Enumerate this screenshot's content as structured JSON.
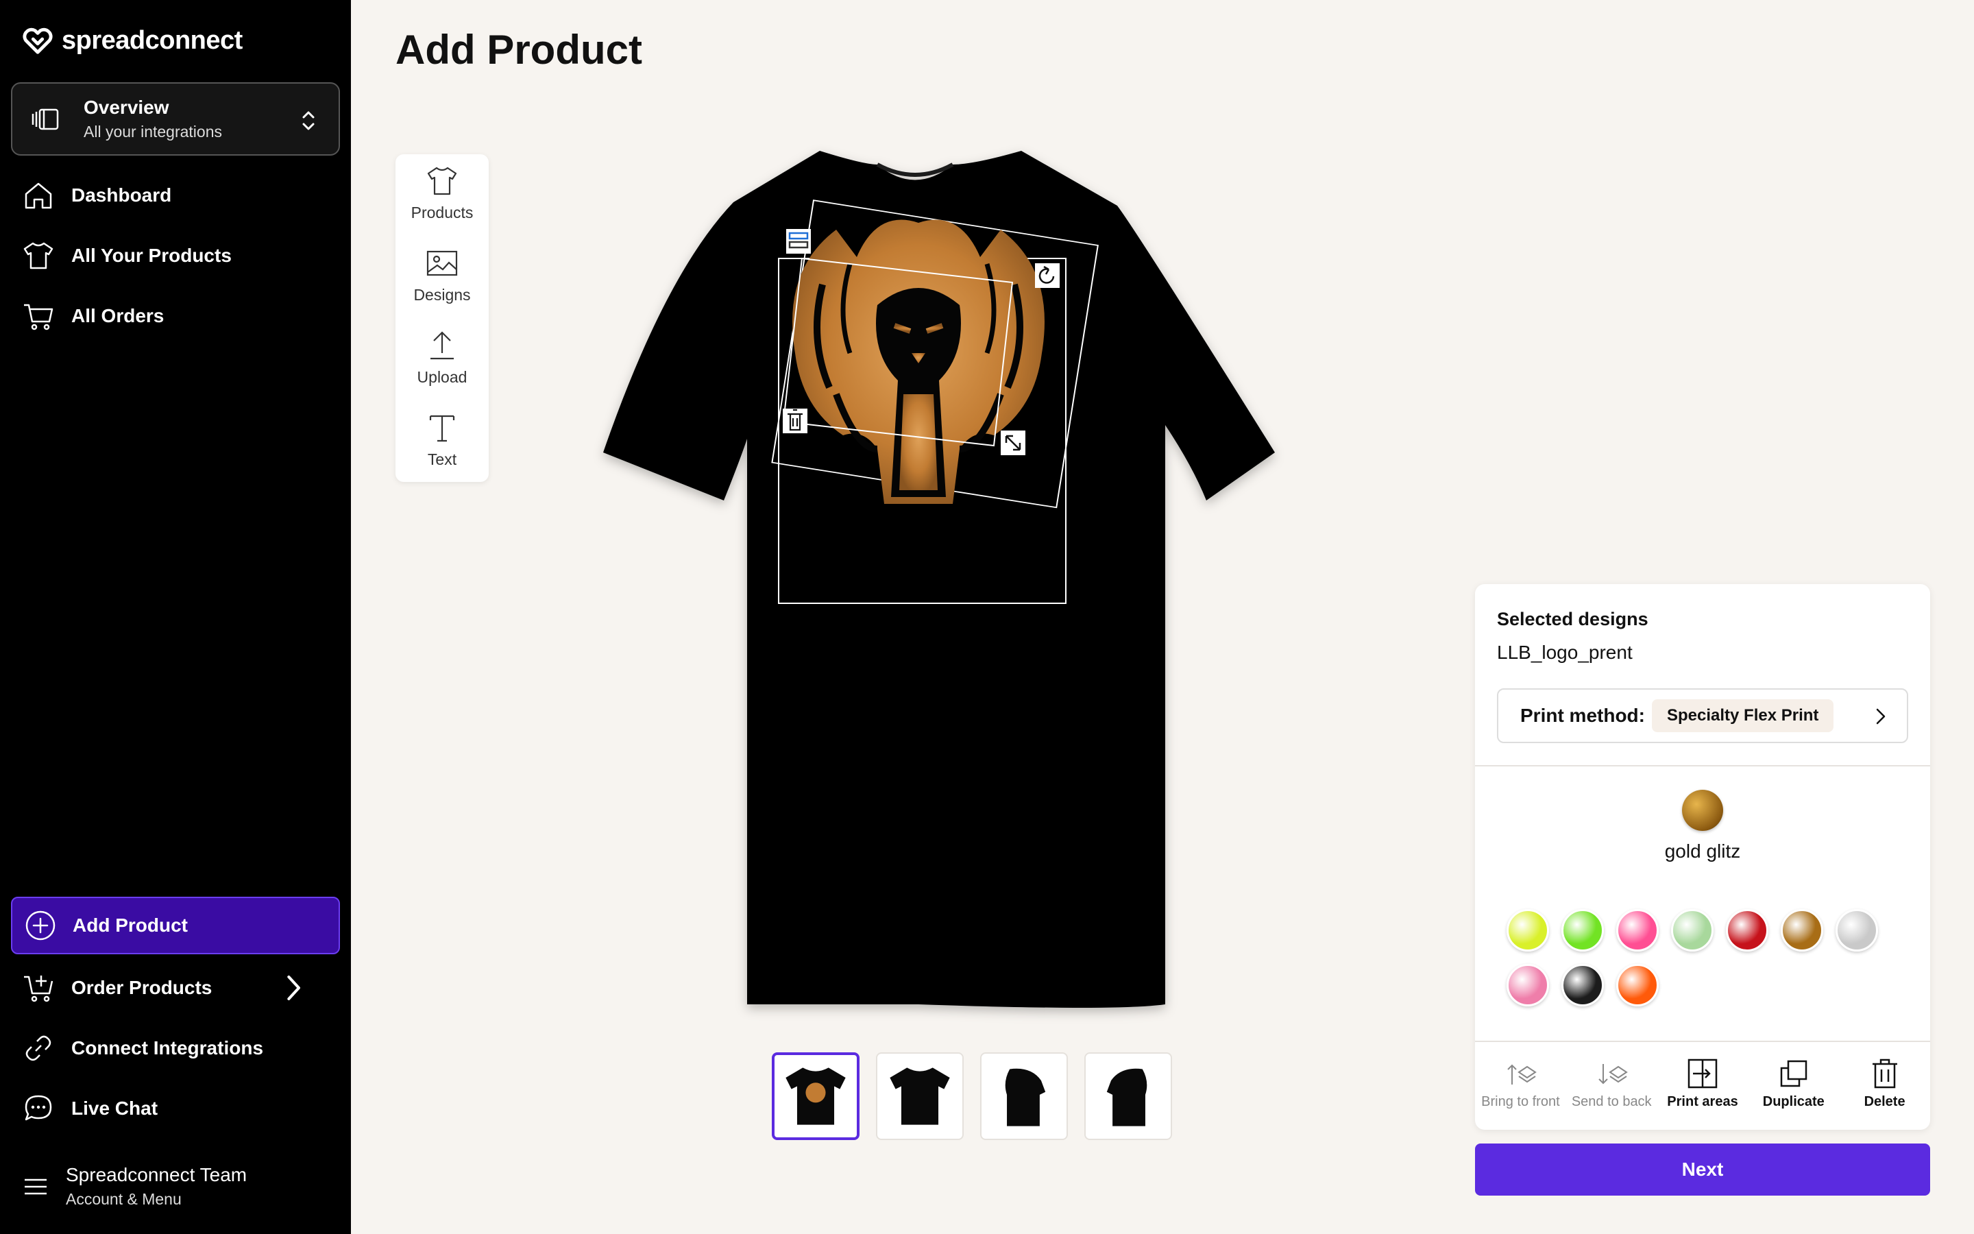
{
  "app": {
    "logo_text": "spreadconnect"
  },
  "integration": {
    "title": "Overview",
    "subtitle": "All your integrations"
  },
  "nav": {
    "dashboard": "Dashboard",
    "all_products": "All Your Products",
    "all_orders": "All Orders",
    "add_product": "Add Product",
    "order_products": "Order Products",
    "connect_integrations": "Connect Integrations",
    "live_chat": "Live Chat"
  },
  "account": {
    "name": "Spreadconnect Team",
    "sub": "Account & Menu"
  },
  "page": {
    "title": "Add Product"
  },
  "tools": {
    "products": "Products",
    "designs": "Designs",
    "upload": "Upload",
    "text": "Text"
  },
  "panel": {
    "selected_title": "Selected designs",
    "design_name": "LLB_logo_prent",
    "print_method_label": "Print method:",
    "print_method_value": "Specialty Flex Print",
    "selected_color_name": "gold glitz",
    "swatches": [
      {
        "name": "neon-yellow",
        "color": "#d9f02a"
      },
      {
        "name": "neon-green",
        "color": "#72e324"
      },
      {
        "name": "neon-pink",
        "color": "#ff4f93"
      },
      {
        "name": "light-green",
        "color": "#a8d89c"
      },
      {
        "name": "red-glitter",
        "color": "#c6121b"
      },
      {
        "name": "gold-glitter",
        "color": "#a86d16"
      },
      {
        "name": "silver-glitter",
        "color": "#c9c9c9"
      },
      {
        "name": "pink-glitter",
        "color": "#ef7eaa"
      },
      {
        "name": "black-glitter",
        "color": "#1c1c1c"
      },
      {
        "name": "neon-orange",
        "color": "#ff5a0a"
      }
    ],
    "actions": {
      "bring_front": "Bring to front",
      "send_back": "Send to back",
      "print_areas": "Print areas",
      "duplicate": "Duplicate",
      "delete": "Delete"
    }
  },
  "buttons": {
    "next": "Next"
  },
  "colors": {
    "accent": "#5b2be0",
    "nav_active": "#3a0ca3",
    "design_gold": "#c98a3b"
  }
}
